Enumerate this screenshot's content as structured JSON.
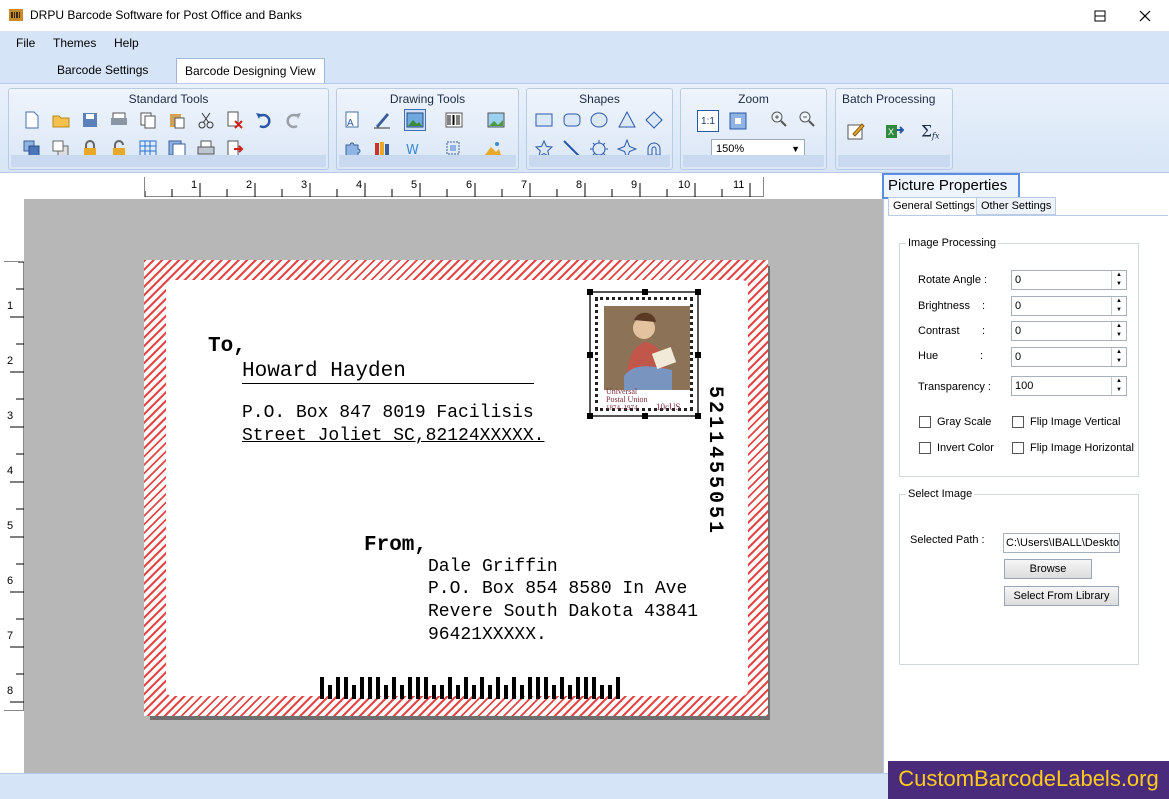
{
  "window": {
    "title": "DRPU Barcode Software for Post Office and Banks"
  },
  "menu": {
    "items": [
      "File",
      "Themes",
      "Help"
    ]
  },
  "tabs": {
    "barcode_settings": "Barcode Settings",
    "barcode_designing_view": "Barcode Designing View"
  },
  "ribbon": {
    "standard_tools": "Standard Tools",
    "drawing_tools": "Drawing Tools",
    "shapes": "Shapes",
    "zoom": "Zoom",
    "zoom_value": "150%",
    "zoom_fit_label": "1:1",
    "batch_processing": "Batch Processing"
  },
  "ruler": {
    "horizontal": [
      "1",
      "2",
      "3",
      "4",
      "5",
      "6",
      "7",
      "8",
      "9",
      "10",
      "11"
    ],
    "vertical": [
      "1",
      "2",
      "3",
      "4",
      "5",
      "6",
      "7",
      "8"
    ]
  },
  "envelope": {
    "to_label": "To,",
    "to_name": "Howard Hayden",
    "to_line1": "P.O. Box 847 8019 Facilisis",
    "to_line2": "Street Joliet SC,82124XXXXX.",
    "from_label": "From,",
    "from_name": "Dale Griffin",
    "from_line1": "P.O. Box 854 8580 In Ave",
    "from_line2": "Revere South Dakota 43841",
    "from_line3": "96421XXXXX.",
    "vertical_code": "5211455051",
    "stamp_line1": "Universal",
    "stamp_line2": "Postal Union",
    "stamp_line3": "1874–1974",
    "stamp_value": "10cUS"
  },
  "picture_properties": {
    "title": "Picture Properties",
    "tab_general": "General Settings",
    "tab_other": "Other Settings",
    "image_processing": "Image Processing",
    "rotate_angle_label": "Rotate Angle :",
    "rotate_angle_value": "0",
    "brightness_label": "Brightness",
    "brightness_value": "0",
    "contrast_label": "Contrast",
    "contrast_value": "0",
    "hue_label": "Hue",
    "hue_value": "0",
    "colon": ":",
    "transparency_label": "Transparency :",
    "transparency_value": "100",
    "gray_scale": "Gray Scale",
    "flip_vertical": "Flip Image Vertical",
    "invert_color": "Invert Color",
    "flip_horizontal": "Flip Image Horizontal",
    "select_image": "Select Image",
    "selected_path_label": "Selected Path :",
    "selected_path_value": "C:\\Users\\IBALL\\Deskto",
    "browse": "Browse",
    "select_from_library": "Select From Library"
  },
  "brand": {
    "text": "CustomBarcodeLabels.org"
  }
}
